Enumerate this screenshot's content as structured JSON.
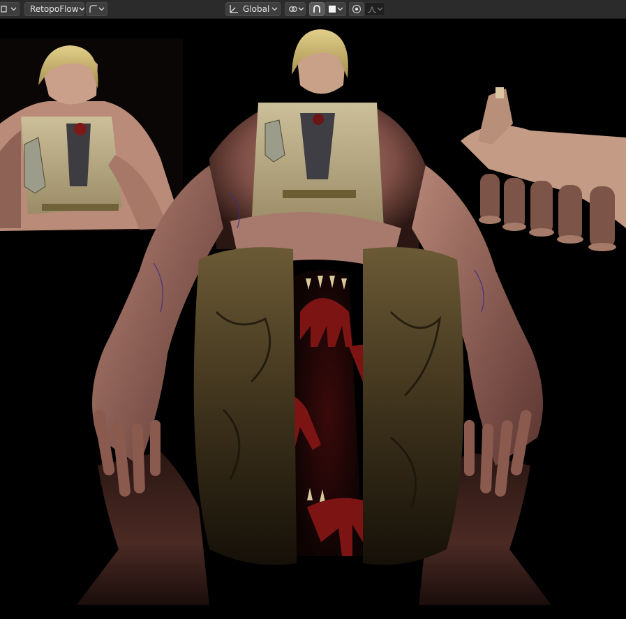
{
  "header": {
    "addon_label": "RetopoFlow",
    "orientation_label": "Global",
    "icons": {
      "editor_type": "editor-type-icon",
      "falloff": "falloff-curve-icon",
      "orientation": "transform-orientation-icon",
      "pivot": "pivot-link-icon",
      "snap": "snap-magnet-icon",
      "snap_target": "snap-target-square-icon",
      "proportional": "proportional-editing-icon",
      "proportional_falloff": "proportional-falloff-icon"
    }
  },
  "viewport": {
    "content": "3d-render-creature-and-character"
  }
}
